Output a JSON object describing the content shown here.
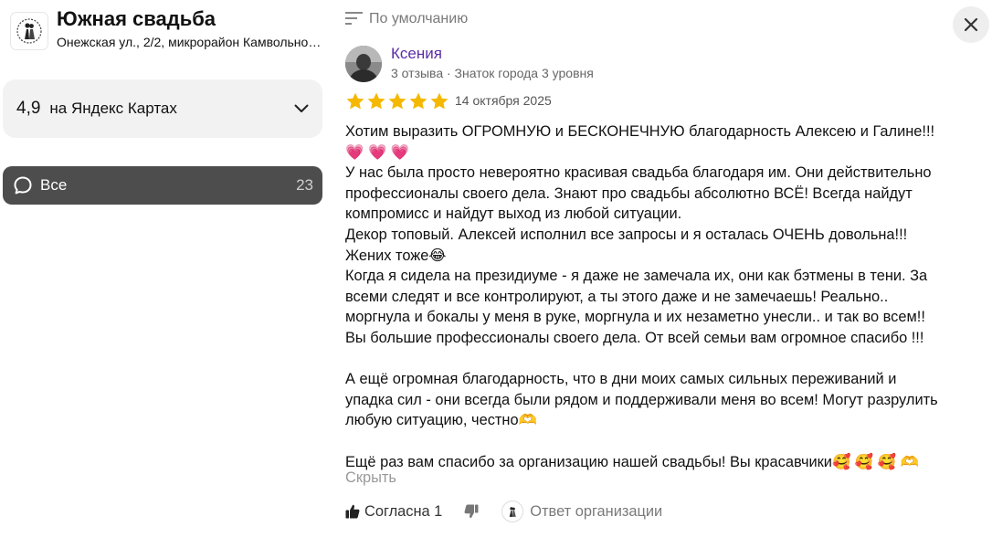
{
  "organization": {
    "name": "Южная свадьба",
    "address": "Онежская ул., 2/2, микрорайон Камвольного комбината"
  },
  "rating": {
    "value": "4,9",
    "source": "на Яндекс Картах"
  },
  "filter": {
    "label": "Все",
    "count": "23"
  },
  "sort": {
    "label": "По умолчанию"
  },
  "review": {
    "author": "Ксения",
    "meta": "3 отзыва · Знаток города 3 уровня",
    "stars": 5,
    "date": "14 октября 2025",
    "text": "Хотим выразить ОГРОМНУЮ и БЕСКОНЕЧНУЮ благодарность Алексею и Галине!!!\n💗 💗 💗\nУ нас была просто невероятно красивая свадьба благодаря им. Они действительно\nпрофессионалы своего дела. Знают про свадьбы абсолютно ВСЁ! Всегда найдут\nкомпромисс и найдут выход из любой ситуации.\nДекор топовый. Алексей исполнил все запросы и я осталась ОЧЕНЬ довольна!!!\nЖених тоже😂\nКогда я сидела на президиуме - я даже не замечала их, они как бэтмены в тени. За\nвсеми следят и все контролируют, а ты этого даже и не замечаешь! Реально..\nморгнула и бокалы у меня в руке, моргнула и их незаметно унесли.. и так во всем!!\nВы большие профессионалы своего дела. От всей семьи вам огромное спасибо !!!\n\nА ещё огромная благодарность, что в дни моих самых сильных переживаний и\nупадка сил - они всегда были рядом и поддерживали меня во всем! Могут разрулить\nлюбую ситуацию, честно🫶\n\nЕщё раз вам спасибо за организацию нашей свадьбы! Вы красавчики🥰 🥰 🥰 🫶",
    "collapse_label": "Скрыть",
    "like_label": "Согласна 1",
    "reply_label": "Ответ организации"
  },
  "colors": {
    "star": "#f5b800",
    "author": "#5a2ea6",
    "chip_bg": "#4d4d4d",
    "card_bg": "#f2f2f2"
  },
  "icons": [
    "logo-icon",
    "chevron-down-icon",
    "chat-bubble-icon",
    "sort-lines-icon",
    "close-icon",
    "star-icon",
    "thumbs-up-icon",
    "thumbs-down-icon",
    "organization-logo-icon"
  ]
}
